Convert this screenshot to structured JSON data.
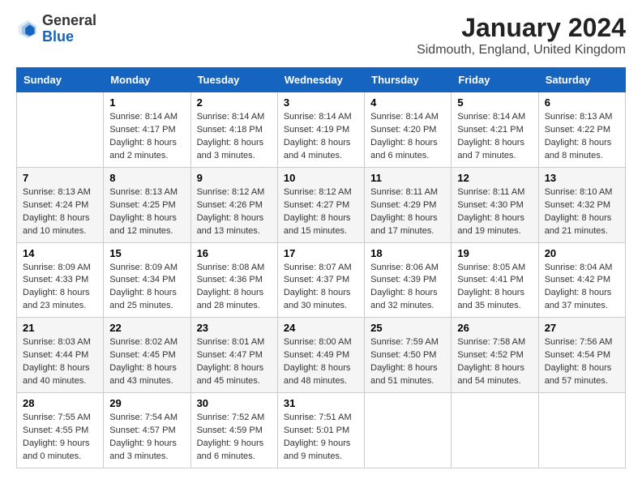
{
  "header": {
    "logo_general": "General",
    "logo_blue": "Blue",
    "month_year": "January 2024",
    "location": "Sidmouth, England, United Kingdom"
  },
  "columns": [
    "Sunday",
    "Monday",
    "Tuesday",
    "Wednesday",
    "Thursday",
    "Friday",
    "Saturday"
  ],
  "rows": [
    [
      {
        "day": "",
        "info": ""
      },
      {
        "day": "1",
        "info": "Sunrise: 8:14 AM\nSunset: 4:17 PM\nDaylight: 8 hours\nand 2 minutes."
      },
      {
        "day": "2",
        "info": "Sunrise: 8:14 AM\nSunset: 4:18 PM\nDaylight: 8 hours\nand 3 minutes."
      },
      {
        "day": "3",
        "info": "Sunrise: 8:14 AM\nSunset: 4:19 PM\nDaylight: 8 hours\nand 4 minutes."
      },
      {
        "day": "4",
        "info": "Sunrise: 8:14 AM\nSunset: 4:20 PM\nDaylight: 8 hours\nand 6 minutes."
      },
      {
        "day": "5",
        "info": "Sunrise: 8:14 AM\nSunset: 4:21 PM\nDaylight: 8 hours\nand 7 minutes."
      },
      {
        "day": "6",
        "info": "Sunrise: 8:13 AM\nSunset: 4:22 PM\nDaylight: 8 hours\nand 8 minutes."
      }
    ],
    [
      {
        "day": "7",
        "info": "Sunrise: 8:13 AM\nSunset: 4:24 PM\nDaylight: 8 hours\nand 10 minutes."
      },
      {
        "day": "8",
        "info": "Sunrise: 8:13 AM\nSunset: 4:25 PM\nDaylight: 8 hours\nand 12 minutes."
      },
      {
        "day": "9",
        "info": "Sunrise: 8:12 AM\nSunset: 4:26 PM\nDaylight: 8 hours\nand 13 minutes."
      },
      {
        "day": "10",
        "info": "Sunrise: 8:12 AM\nSunset: 4:27 PM\nDaylight: 8 hours\nand 15 minutes."
      },
      {
        "day": "11",
        "info": "Sunrise: 8:11 AM\nSunset: 4:29 PM\nDaylight: 8 hours\nand 17 minutes."
      },
      {
        "day": "12",
        "info": "Sunrise: 8:11 AM\nSunset: 4:30 PM\nDaylight: 8 hours\nand 19 minutes."
      },
      {
        "day": "13",
        "info": "Sunrise: 8:10 AM\nSunset: 4:32 PM\nDaylight: 8 hours\nand 21 minutes."
      }
    ],
    [
      {
        "day": "14",
        "info": "Sunrise: 8:09 AM\nSunset: 4:33 PM\nDaylight: 8 hours\nand 23 minutes."
      },
      {
        "day": "15",
        "info": "Sunrise: 8:09 AM\nSunset: 4:34 PM\nDaylight: 8 hours\nand 25 minutes."
      },
      {
        "day": "16",
        "info": "Sunrise: 8:08 AM\nSunset: 4:36 PM\nDaylight: 8 hours\nand 28 minutes."
      },
      {
        "day": "17",
        "info": "Sunrise: 8:07 AM\nSunset: 4:37 PM\nDaylight: 8 hours\nand 30 minutes."
      },
      {
        "day": "18",
        "info": "Sunrise: 8:06 AM\nSunset: 4:39 PM\nDaylight: 8 hours\nand 32 minutes."
      },
      {
        "day": "19",
        "info": "Sunrise: 8:05 AM\nSunset: 4:41 PM\nDaylight: 8 hours\nand 35 minutes."
      },
      {
        "day": "20",
        "info": "Sunrise: 8:04 AM\nSunset: 4:42 PM\nDaylight: 8 hours\nand 37 minutes."
      }
    ],
    [
      {
        "day": "21",
        "info": "Sunrise: 8:03 AM\nSunset: 4:44 PM\nDaylight: 8 hours\nand 40 minutes."
      },
      {
        "day": "22",
        "info": "Sunrise: 8:02 AM\nSunset: 4:45 PM\nDaylight: 8 hours\nand 43 minutes."
      },
      {
        "day": "23",
        "info": "Sunrise: 8:01 AM\nSunset: 4:47 PM\nDaylight: 8 hours\nand 45 minutes."
      },
      {
        "day": "24",
        "info": "Sunrise: 8:00 AM\nSunset: 4:49 PM\nDaylight: 8 hours\nand 48 minutes."
      },
      {
        "day": "25",
        "info": "Sunrise: 7:59 AM\nSunset: 4:50 PM\nDaylight: 8 hours\nand 51 minutes."
      },
      {
        "day": "26",
        "info": "Sunrise: 7:58 AM\nSunset: 4:52 PM\nDaylight: 8 hours\nand 54 minutes."
      },
      {
        "day": "27",
        "info": "Sunrise: 7:56 AM\nSunset: 4:54 PM\nDaylight: 8 hours\nand 57 minutes."
      }
    ],
    [
      {
        "day": "28",
        "info": "Sunrise: 7:55 AM\nSunset: 4:55 PM\nDaylight: 9 hours\nand 0 minutes."
      },
      {
        "day": "29",
        "info": "Sunrise: 7:54 AM\nSunset: 4:57 PM\nDaylight: 9 hours\nand 3 minutes."
      },
      {
        "day": "30",
        "info": "Sunrise: 7:52 AM\nSunset: 4:59 PM\nDaylight: 9 hours\nand 6 minutes."
      },
      {
        "day": "31",
        "info": "Sunrise: 7:51 AM\nSunset: 5:01 PM\nDaylight: 9 hours\nand 9 minutes."
      },
      {
        "day": "",
        "info": ""
      },
      {
        "day": "",
        "info": ""
      },
      {
        "day": "",
        "info": ""
      }
    ]
  ]
}
